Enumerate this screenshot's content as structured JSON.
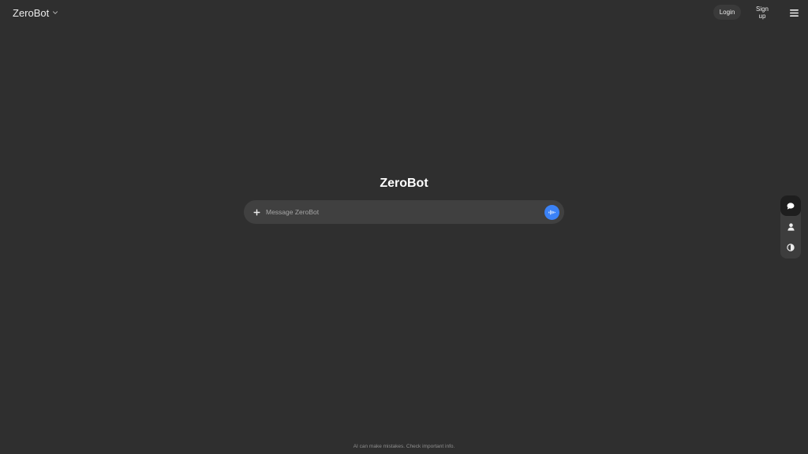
{
  "header": {
    "model_name": "ZeroBot",
    "login_label": "Login",
    "signup_label": "Sign up",
    "icons": {
      "model_chevron": "chevron-down-icon",
      "menu": "hamburger-menu-icon"
    }
  },
  "main": {
    "title": "ZeroBot"
  },
  "composer": {
    "placeholder": "Message ZeroBot",
    "value": "",
    "icons": {
      "attach": "plus-icon",
      "voice": "audio-waveform-icon"
    },
    "voice_button_color": "#3b82f6"
  },
  "side_toolbar": {
    "items": [
      {
        "icon": "chat-bubble-icon",
        "active": true
      },
      {
        "icon": "user-icon",
        "active": false
      },
      {
        "icon": "theme-contrast-icon",
        "active": false
      }
    ]
  },
  "footer": {
    "note": "AI can make mistakes. Check important info."
  },
  "colors": {
    "background": "#2f2f2f",
    "composer_background": "#404040",
    "accent": "#3b82f6",
    "text": "#ececec"
  }
}
